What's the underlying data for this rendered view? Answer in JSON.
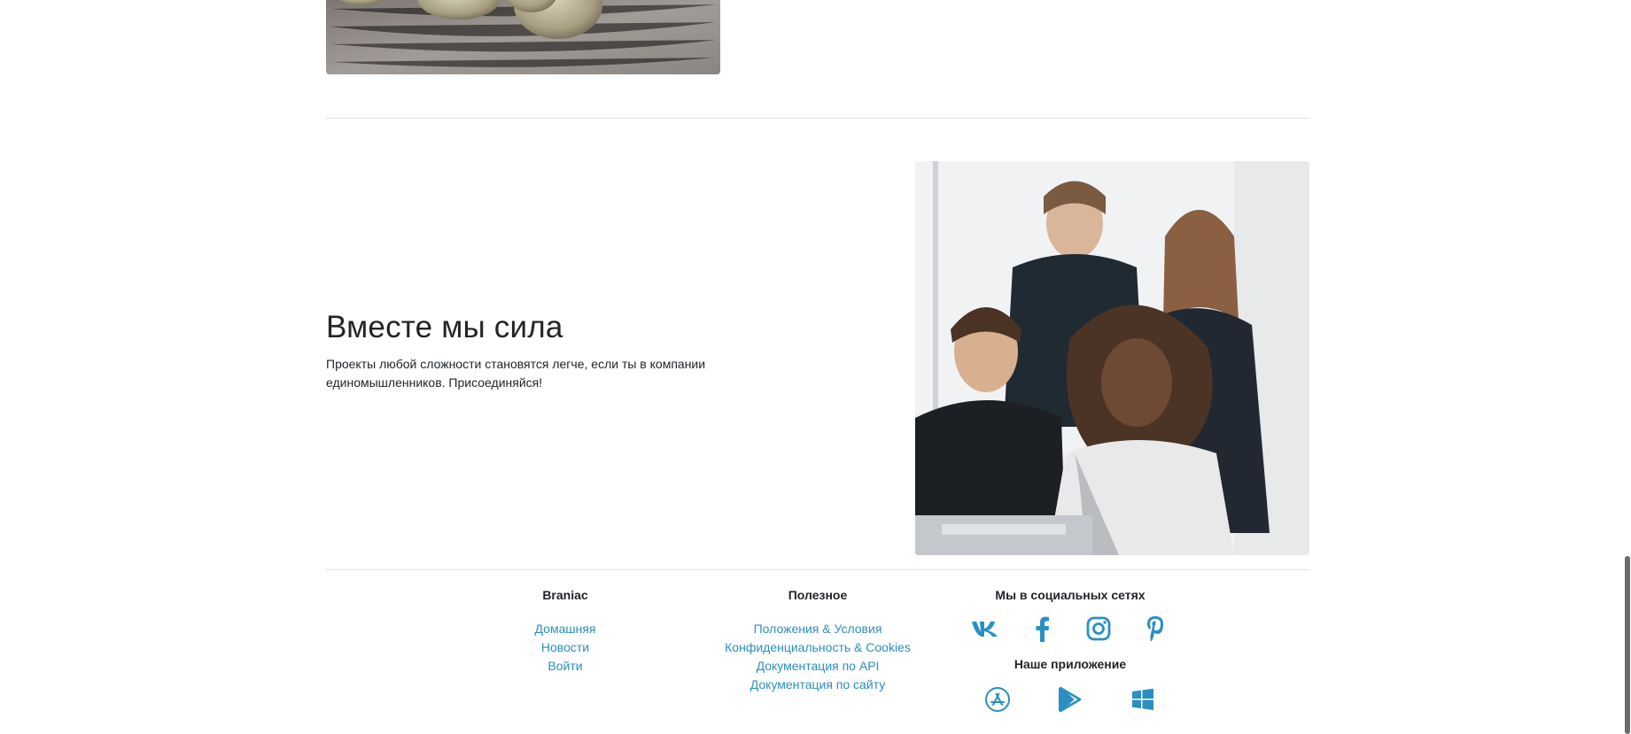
{
  "feature": {
    "title": "Вместе мы сила",
    "text": "Проекты любой сложности становятся легче, если ты в компании единомышленников. Присоединяйся!"
  },
  "footer": {
    "brand": {
      "title": "Braniac",
      "links": [
        "Домашняя",
        "Новости",
        "Войти"
      ]
    },
    "useful": {
      "title": "Полезное",
      "links": [
        "Положения & Условия",
        "Конфиденциальность & Cookies",
        "Документация по API",
        "Документация по сайту"
      ]
    },
    "social": {
      "title": "Мы в социальных сетях",
      "icons": [
        "vk-icon",
        "facebook-icon",
        "instagram-icon",
        "pinterest-icon"
      ]
    },
    "apps": {
      "title": "Наше приложение",
      "icons": [
        "app-store-icon",
        "google-play-icon",
        "windows-icon"
      ]
    }
  },
  "colors": {
    "link": "#2a8fc2",
    "text": "#212529",
    "divider": "#dee2e6"
  }
}
